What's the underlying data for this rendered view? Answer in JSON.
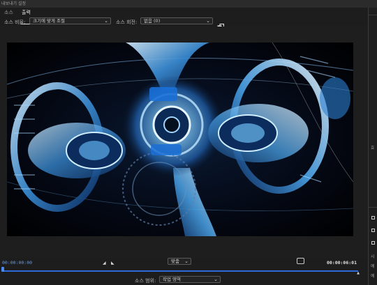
{
  "window": {
    "title": "내보내기 설정"
  },
  "tabs": [
    {
      "label": "소스",
      "active": false
    },
    {
      "label": "출력",
      "active": true
    }
  ],
  "source_bar": {
    "scaling_label": "소스 비율:",
    "scaling_value": "크기에 맞게 조절",
    "rotation_label": "소스 회전:",
    "rotation_value": "없음 (0)"
  },
  "playback": {
    "current_timecode": "00:00:00:00",
    "duration_timecode": "00:00:06:01",
    "fit_value": "맞춤",
    "playhead_position": 0.0
  },
  "range": {
    "label": "소스 범위:",
    "value": "작업 영역"
  },
  "right_panel": {
    "labels": [
      "효",
      "시",
      "예",
      "예"
    ]
  },
  "colors": {
    "accent": "#4a8af5",
    "timecode_in": "#5b9cf4",
    "background": "#1d1d1d"
  },
  "icons": {
    "crop": "crop-icon",
    "in_point": "in-point-marker-icon",
    "out_point": "out-point-marker-icon",
    "snapshot": "snapshot-icon"
  }
}
